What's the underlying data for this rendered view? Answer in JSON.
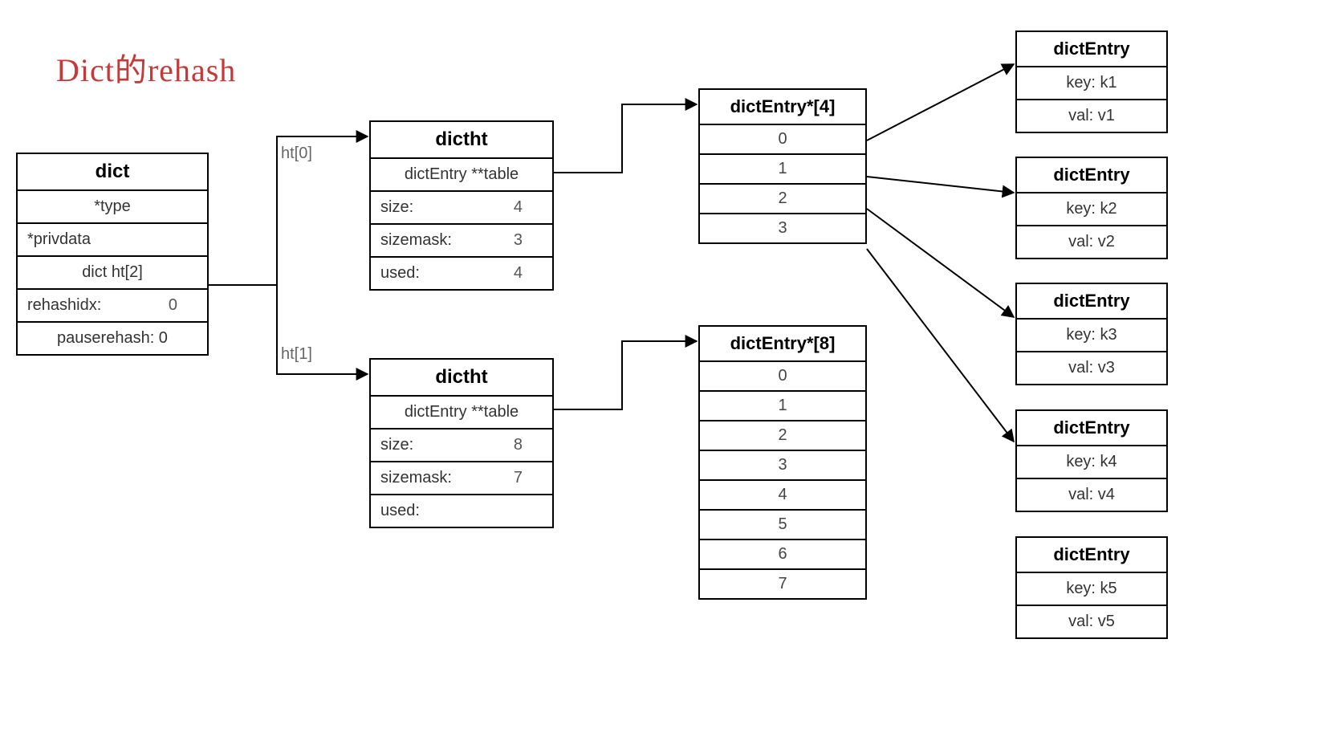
{
  "title": "Dict的rehash",
  "labels": {
    "ht0": "ht[0]",
    "ht1": "ht[1]"
  },
  "dict": {
    "header": "dict",
    "type": "*type",
    "privdata": "*privdata",
    "ht": "dict ht[2]",
    "rehashidx_label": "rehashidx:",
    "rehashidx_val": "0",
    "pauserehash": "pauserehash: 0"
  },
  "dictht0": {
    "header": "dictht",
    "table": "dictEntry **table",
    "size_label": "size:",
    "size_val": "4",
    "sizemask_label": "sizemask:",
    "sizemask_val": "3",
    "used_label": "used:",
    "used_val": "4"
  },
  "dictht1": {
    "header": "dictht",
    "table": "dictEntry **table",
    "size_label": "size:",
    "size_val": "8",
    "sizemask_label": "sizemask:",
    "sizemask_val": "7",
    "used_label": "used:",
    "used_val": ""
  },
  "arr4": {
    "header": "dictEntry*[4]",
    "slots": [
      "0",
      "1",
      "2",
      "3"
    ]
  },
  "arr8": {
    "header": "dictEntry*[8]",
    "slots": [
      "0",
      "1",
      "2",
      "3",
      "4",
      "5",
      "6",
      "7"
    ]
  },
  "entries": [
    {
      "header": "dictEntry",
      "key": "key: k1",
      "val": "val: v1"
    },
    {
      "header": "dictEntry",
      "key": "key: k2",
      "val": "val: v2"
    },
    {
      "header": "dictEntry",
      "key": "key: k3",
      "val": "val: v3"
    },
    {
      "header": "dictEntry",
      "key": "key: k4",
      "val": "val: v4"
    },
    {
      "header": "dictEntry",
      "key": "key: k5",
      "val": "val: v5"
    }
  ]
}
